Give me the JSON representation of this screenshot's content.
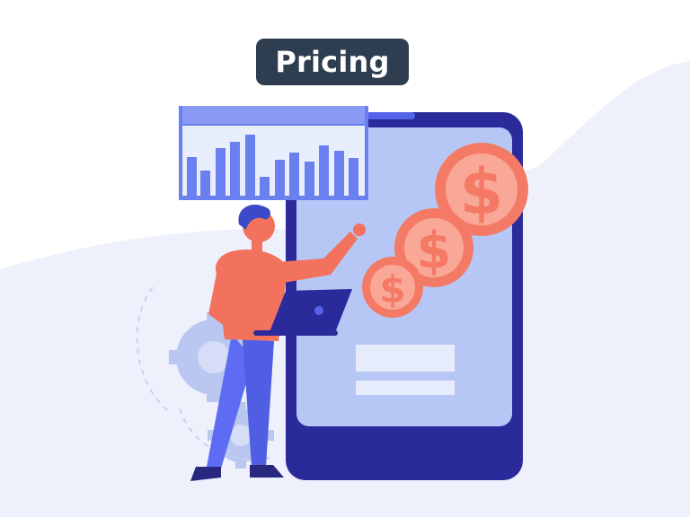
{
  "header": {
    "title": "Pricing"
  },
  "illustration": {
    "icons": [
      "bar-chart-icon",
      "tablet-device",
      "dollar-coin-icon",
      "gear-icon",
      "laptop-icon",
      "person-figure"
    ],
    "colors": {
      "background_wave": "#eef1fb",
      "badge_bg": "#2e3d4f",
      "badge_text": "#ffffff",
      "tablet_frame": "#2a2a9a",
      "tablet_screen": "#b6c7f6",
      "coin": "#f47a66",
      "shirt": "#f2725e",
      "pants": "#5d6cf2",
      "chart_bars": "#6a7ff0"
    }
  }
}
